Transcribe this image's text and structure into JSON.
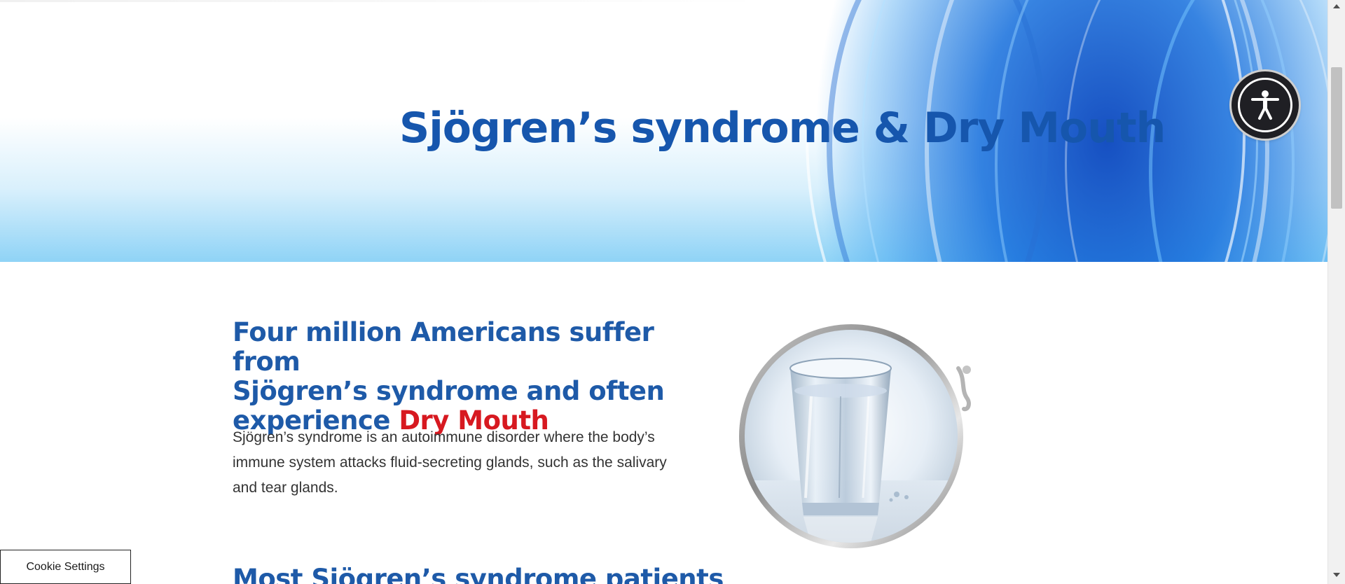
{
  "hero": {
    "title": "Sjögren’s syndrome & Dry Mouth"
  },
  "accessibility": {
    "icon": "accessibility-person-icon",
    "color": "#1f1f24"
  },
  "intro": {
    "headline_line1": "Four million Americans suffer from",
    "headline_line2": "Sjögren’s syndrome and often",
    "headline_line3_prefix": "experience ",
    "headline_accent": "Dry Mouth",
    "body": "Sjögren’s syndrome is an autoimmune disorder where the body’s immune system attacks fluid-secreting glands, such as the salivary and tear glands."
  },
  "next_section": {
    "headline": "Most Sjögren’s syndrome patients"
  },
  "image": {
    "subject": "glass-of-water-image"
  },
  "cookie": {
    "label": "Cookie Settings"
  },
  "colors": {
    "brand_blue": "#1e5aa8",
    "accent_red": "#d71920",
    "hero_title": "#1656ad"
  }
}
